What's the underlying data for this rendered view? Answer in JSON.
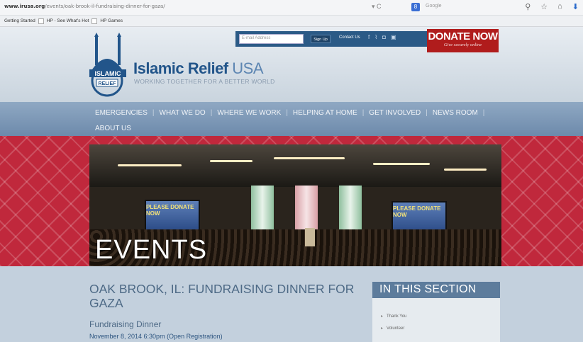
{
  "browser": {
    "url_host": "www.irusa.org",
    "url_path": "/events/oak-brook-il-fundraising-dinner-for-gaza/",
    "search_engine": "Google",
    "bookmarks": [
      "Getting Started",
      "HP - See What's Hot",
      "HP Games"
    ]
  },
  "header": {
    "email_placeholder": "E-mail Address",
    "signup_label": "Sign Up",
    "contact_label": "Contact Us",
    "donate_title": "DONATE NOW",
    "donate_sub": "Give securely online",
    "brand_name": "Islamic Relief",
    "brand_country": " USA",
    "tagline": "WORKING TOGETHER FOR A BETTER WORLD",
    "logo_text_1": "ISLAMIC",
    "logo_text_2": "RELIEF"
  },
  "nav": {
    "items": [
      "EMERGENCIES",
      "WHAT WE DO",
      "WHERE WE WORK",
      "HELPING AT HOME",
      "GET INVOLVED",
      "NEWS ROOM"
    ],
    "row2": "ABOUT US"
  },
  "banner": {
    "title": "EVENTS",
    "screen_text": "PLEASE DONATE NOW"
  },
  "main": {
    "title": "OAK BROOK, IL: FUNDRAISING DINNER FOR GAZA",
    "event_type": "Fundraising Dinner",
    "event_date": "November 8, 2014 6:30pm (Open Registration)"
  },
  "sidebar": {
    "title": "IN THIS SECTION",
    "items": [
      "Thank You",
      "Volunteer"
    ]
  },
  "colors": {
    "brand_blue": "#22558a",
    "donate_red": "#b01c1c",
    "banner_red": "#c0283c",
    "nav_blue": "#7b96b5"
  }
}
